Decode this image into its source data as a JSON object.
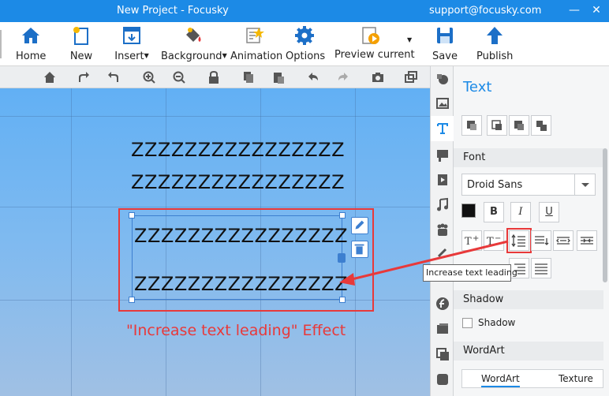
{
  "titlebar": {
    "title": "New Project - Focusky",
    "support": "support@focusky.com",
    "minimize": "—",
    "close": "✕"
  },
  "ribbon": {
    "home": "Home",
    "new": "New",
    "insert": "Insert",
    "background": "Background",
    "animation": "Animation",
    "options": "Options",
    "preview": "Preview current",
    "save": "Save",
    "publish": "Publish"
  },
  "canvas": {
    "lines_top": [
      "ZZZZZZZZZZZZZZZZ",
      "ZZZZZZZZZZZZZZZZ"
    ],
    "lines_selected": [
      "ZZZZZZZZZZZZZZZZ",
      "ZZZZZZZZZZZZZZZZ"
    ],
    "effect_label": "\"Increase text leading\" Effect"
  },
  "panel": {
    "title": "Text",
    "font_section": "Font",
    "font_name": "Droid Sans",
    "bold": "B",
    "italic": "I",
    "underline": "U",
    "tooltip": "Increase text leading",
    "shadow_section": "Shadow",
    "shadow_checkbox": "Shadow",
    "wordart_section": "WordArt",
    "tab_wordart": "WordArt",
    "tab_texture": "Texture"
  },
  "colors": {
    "accent": "#1c8ae6",
    "highlight": "#e8393a",
    "selection": "#3d7fd0",
    "text_color": "#111111"
  }
}
